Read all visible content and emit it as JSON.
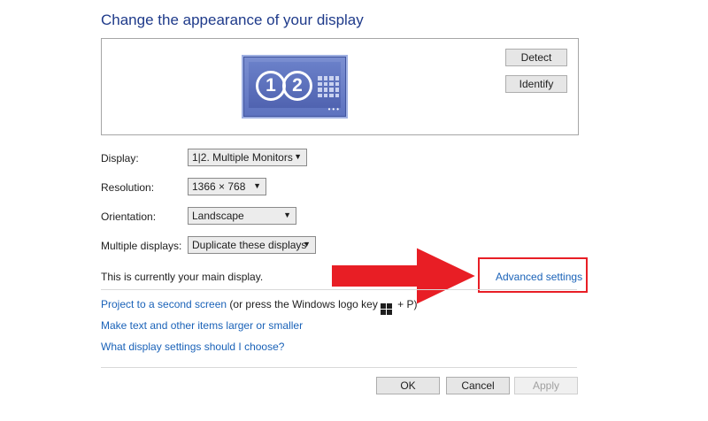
{
  "page": {
    "title": "Change the appearance of your display"
  },
  "preview": {
    "detect_label": "Detect",
    "identify_label": "Identify",
    "monitor": {
      "left_number": "1",
      "right_number": "2",
      "dots": "•••"
    }
  },
  "settings": {
    "display": {
      "label": "Display:",
      "value": "1|2. Multiple Monitors"
    },
    "resolution": {
      "label": "Resolution:",
      "value": "1366 × 768"
    },
    "orientation": {
      "label": "Orientation:",
      "value": "Landscape"
    },
    "multiple_displays": {
      "label": "Multiple displays:",
      "value": "Duplicate these displays"
    }
  },
  "main_display_text": "This is currently your main display.",
  "advanced_settings_link": "Advanced settings",
  "links": {
    "project_link": "Project to a second screen",
    "project_tail_prefix": " (or press the Windows logo key",
    "project_tail_suffix": " + P)",
    "text_size": "Make text and other items larger or smaller",
    "which_settings": "What display settings should I choose?"
  },
  "footer": {
    "ok_label": "OK",
    "cancel_label": "Cancel",
    "apply_label": "Apply"
  },
  "colors": {
    "title_blue": "#1e3a8a",
    "link_blue": "#1a62b8",
    "annotation_red": "#e81e25"
  },
  "icons": {
    "chevron": "chevron-down-icon",
    "windows": "windows-logo-icon",
    "arrow": "red-arrow-annotation"
  }
}
